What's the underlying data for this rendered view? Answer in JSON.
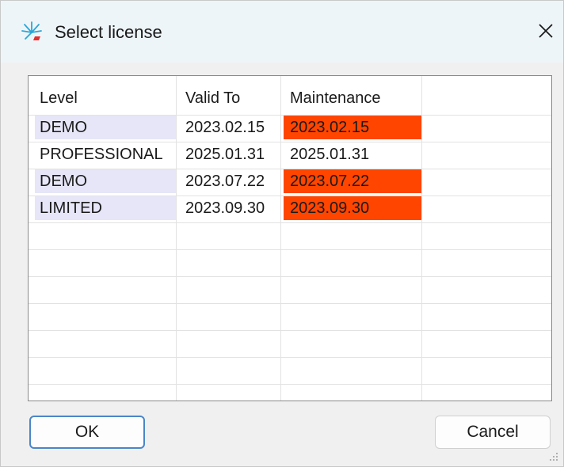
{
  "window": {
    "title": "Select license",
    "icon": "sparkle-app-icon",
    "close_icon": "close-icon"
  },
  "grid": {
    "columns": [
      "Level",
      "Valid To",
      "Maintenance"
    ],
    "rows": [
      {
        "level": "DEMO",
        "valid_to": "2023.02.15",
        "maintenance": "2023.02.15",
        "maintenance_expired": true
      },
      {
        "level": "PROFESSIONAL",
        "valid_to": "2025.01.31",
        "maintenance": "2025.01.31",
        "maintenance_expired": false
      },
      {
        "level": "DEMO",
        "valid_to": "2023.07.22",
        "maintenance": "2023.07.22",
        "maintenance_expired": true
      },
      {
        "level": "LIMITED",
        "valid_to": "2023.09.30",
        "maintenance": "2023.09.30",
        "maintenance_expired": true
      }
    ]
  },
  "buttons": {
    "ok_label": "OK",
    "cancel_label": "Cancel"
  },
  "colors": {
    "expired": "#ff4500",
    "level_highlight": "#e6e6f8",
    "ok_border": "#4a86c8",
    "titlebar": "#eef5f8"
  }
}
